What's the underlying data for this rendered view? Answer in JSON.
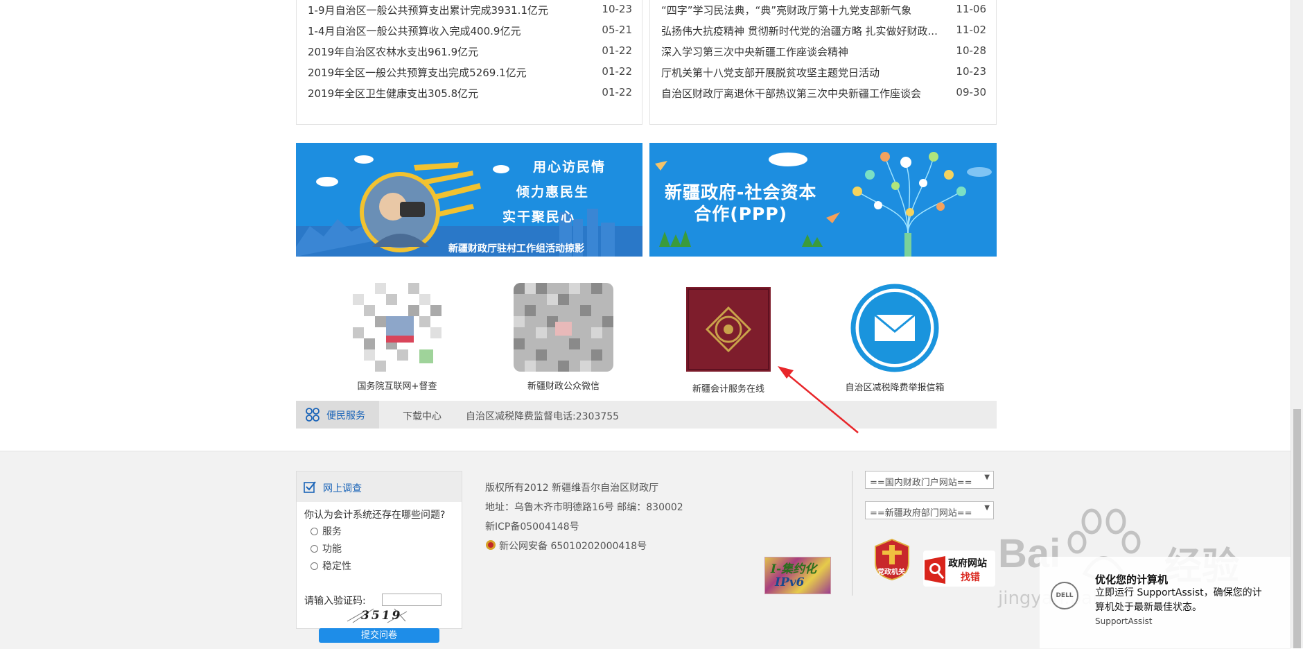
{
  "left_news": [
    {
      "title": "1-9月自治区一般公共预算支出累计完成3931.1亿元",
      "date": "10-23"
    },
    {
      "title": "1-4月自治区一般公共预算收入完成400.9亿元",
      "date": "05-21"
    },
    {
      "title": "2019年自治区农林水支出961.9亿元",
      "date": "01-22"
    },
    {
      "title": "2019年全区一般公共预算支出完成5269.1亿元",
      "date": "01-22"
    },
    {
      "title": "2019年全区卫生健康支出305.8亿元",
      "date": "01-22"
    }
  ],
  "right_news": [
    {
      "title": "“四字”学习民法典，“典”亮财政厅第十九党支部新气象",
      "date": "11-06"
    },
    {
      "title": "弘扬伟大抗疫精神 贯彻新时代党的治疆方略 扎实做好财政...",
      "date": "11-02"
    },
    {
      "title": "深入学习第三次中央新疆工作座谈会精神",
      "date": "10-28"
    },
    {
      "title": "厅机关第十八党支部开展脱贫攻坚主题党日活动",
      "date": "10-23"
    },
    {
      "title": "自治区财政厅离退休干部热议第三次中央新疆工作座谈会",
      "date": "09-30"
    }
  ],
  "banner_left": {
    "line1": "用心访民情",
    "line2": "倾力惠民生",
    "line3": "实干聚民心",
    "caption": "新疆财政厅驻村工作组活动掠影"
  },
  "banner_right": {
    "title_line1": "新疆政府-社会资本",
    "title_line2": "合作(PPP)"
  },
  "links": [
    {
      "label": "国务院互联网+督查",
      "icon": "qr-code"
    },
    {
      "label": "新疆财政公众微信",
      "icon": "qr-code"
    },
    {
      "label": "新疆会计服务在线",
      "icon": "certificate-book"
    },
    {
      "label": "自治区减税降费举报信箱",
      "icon": "mail-icon"
    }
  ],
  "service_bar": {
    "title": "便民服务",
    "download": "下载中心",
    "hotline": "自治区减税降费监督电话:2303755"
  },
  "survey": {
    "title": "网上调查",
    "question": "你认为会计系统还存在哪些问题?",
    "options": [
      "服务",
      "功能",
      "稳定性"
    ],
    "captcha_label": "请输入验证码:",
    "captcha_input_value": "",
    "captcha_text": "3519",
    "submit_label": "提交问卷"
  },
  "footer_info": {
    "copyright": "版权所有2012 新疆维吾尔自治区财政厅",
    "address": "地址：乌鲁木齐市明德路16号 邮编：830002",
    "icp": "新ICP备05004148号",
    "police": "新公网安备 65010202000418号"
  },
  "ipv6_badge": {
    "line1": "I-集约化",
    "line2": "IPv6"
  },
  "selects": {
    "domestic": "==国内财政门户网站==",
    "xinjiang": "==新疆政府部门网站=="
  },
  "badges": {
    "party_gov": "党政机关",
    "gov_site_title": "政府网站",
    "gov_site_sub": "找错"
  },
  "watermark": {
    "logo": "Bai",
    "logo_cn": "经验",
    "url": "jingyan.baidu.com"
  },
  "notification": {
    "brand": "DELL",
    "title": "优化您的计算机",
    "body": "立即运行 SupportAssist，确保您的计算机处于最新最佳状态。",
    "source": "SupportAssist"
  },
  "colors": {
    "accent": "#1e8de8",
    "banner": "#1d8ee0",
    "link_blue": "#1a64b8",
    "arrow_red": "#e8262a"
  }
}
